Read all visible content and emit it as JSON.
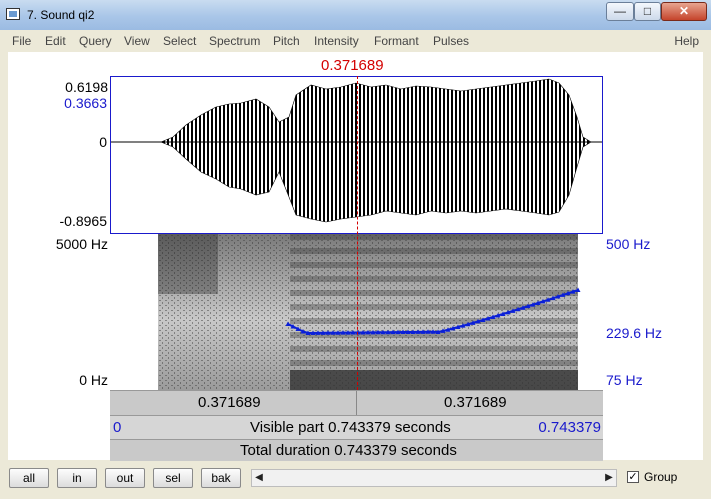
{
  "window": {
    "title": "7. Sound qi2",
    "min_glyph": "—",
    "max_glyph": "□",
    "close_glyph": "✕"
  },
  "menu": {
    "items": [
      "File",
      "Edit",
      "Query",
      "View",
      "Select",
      "Spectrum",
      "Pitch",
      "Intensity",
      "Formant",
      "Pulses"
    ],
    "help": "Help"
  },
  "cursor": {
    "time_label": "0.371689"
  },
  "waveform": {
    "y_max": "0.6198",
    "y_max_selected": "0.3663",
    "y_zero": "0",
    "y_min": "-0.8965"
  },
  "spectrogram": {
    "freq_top": "5000 Hz",
    "freq_bottom": "0 Hz",
    "pitch_top": "500 Hz",
    "pitch_cursor": "229.6 Hz",
    "pitch_bottom": "75 Hz"
  },
  "bars": {
    "left_time": "0.371689",
    "right_time": "0.371689",
    "visible_start": "0",
    "visible_text": "Visible part 0.743379 seconds",
    "visible_end": "0.743379",
    "total_text": "Total duration 0.743379 seconds"
  },
  "toolbar": {
    "all": "all",
    "in": "in",
    "out": "out",
    "sel": "sel",
    "bak": "bak",
    "group_label": "Group",
    "group_checked": true,
    "check_glyph": "✓",
    "left_arrow": "◀",
    "right_arrow": "▶"
  },
  "colors": {
    "waveform": "#000000",
    "pitch": "#0a1fd8",
    "cursor": "#d40000",
    "axis_blue": "#1a1acc"
  }
}
